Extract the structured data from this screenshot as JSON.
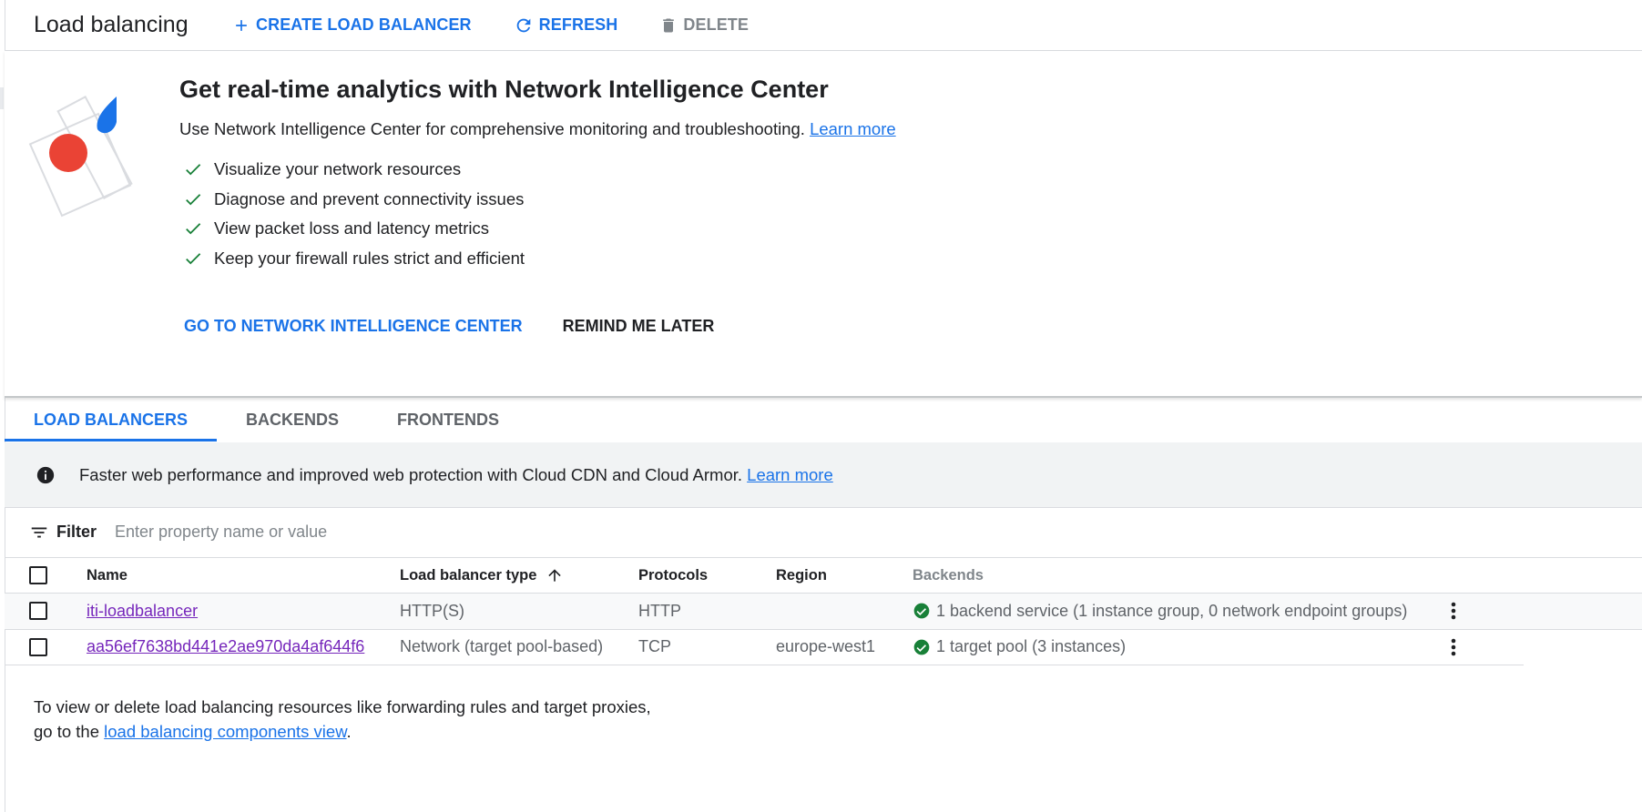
{
  "header": {
    "title": "Load balancing",
    "create_label": "CREATE LOAD BALANCER",
    "refresh_label": "REFRESH",
    "delete_label": "DELETE"
  },
  "promo": {
    "title": "Get real-time analytics with Network Intelligence Center",
    "subtitle": "Use Network Intelligence Center for comprehensive monitoring and troubleshooting.",
    "learn_more": "Learn more",
    "checklist": [
      "Visualize your network resources",
      "Diagnose and prevent connectivity issues",
      "View packet loss and latency metrics",
      "Keep your firewall rules strict and efficient"
    ],
    "primary_action": "GO TO NETWORK INTELLIGENCE CENTER",
    "secondary_action": "REMIND ME LATER"
  },
  "tabs": [
    "LOAD BALANCERS",
    "BACKENDS",
    "FRONTENDS"
  ],
  "info_banner": {
    "message": "Faster web performance and improved web protection with Cloud CDN and Cloud Armor.",
    "link": "Learn more"
  },
  "filter": {
    "label": "Filter",
    "placeholder": "Enter property name or value"
  },
  "table": {
    "columns": {
      "name": "Name",
      "type": "Load balancer type",
      "protocols": "Protocols",
      "region": "Region",
      "backends": "Backends"
    },
    "rows": [
      {
        "name": "iti-loadbalancer",
        "type": "HTTP(S)",
        "protocols": "HTTP",
        "region": "",
        "backends": "1 backend service (1 instance group, 0 network endpoint groups)"
      },
      {
        "name": "aa56ef7638bd441e2ae970da4af644f6",
        "type": "Network (target pool-based)",
        "protocols": "TCP",
        "region": "europe-west1",
        "backends": "1 target pool (3 instances)"
      }
    ]
  },
  "footer": {
    "text_before": "To view or delete load balancing resources like forwarding rules and target proxies, go to the",
    "link": "load balancing components view",
    "text_after": "."
  },
  "colors": {
    "accent": "#1a73e8",
    "success": "#188038",
    "visited_link": "#7627bb",
    "illustration_red": "#ea4335",
    "illustration_blue": "#1a73e8"
  },
  "icons": {
    "create": "plus-icon",
    "refresh": "refresh-icon",
    "delete": "trash-icon",
    "check": "check-icon",
    "info": "info-icon",
    "filter": "filter-icon",
    "sort": "arrow-up-icon",
    "status": "check-circle-icon",
    "more": "more-vert-icon"
  }
}
